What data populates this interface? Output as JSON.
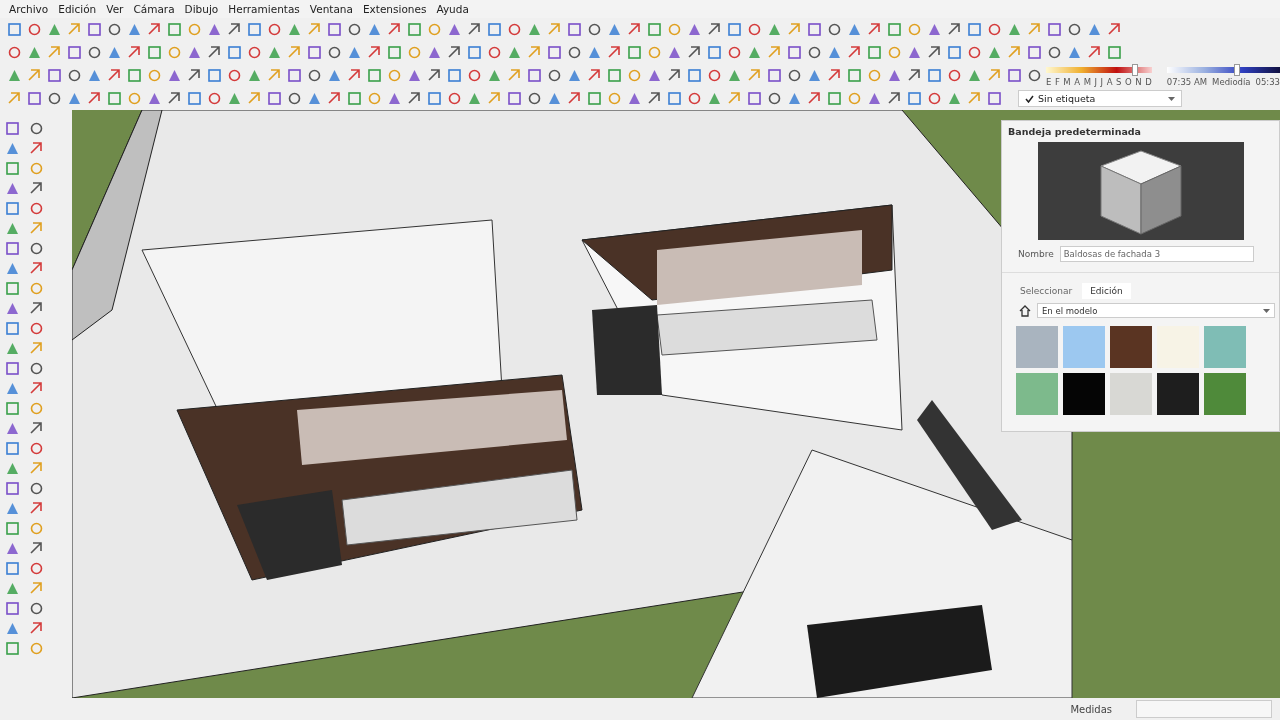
{
  "menu": [
    "Archivo",
    "Edición",
    "Ver",
    "Cámara",
    "Dibujo",
    "Herramientas",
    "Ventana",
    "Extensiones",
    "Ayuda"
  ],
  "shadows": {
    "months": [
      "E",
      "F",
      "M",
      "A",
      "M",
      "J",
      "J",
      "A",
      "S",
      "O",
      "N",
      "D"
    ],
    "month_slider": {
      "level": 0.84
    },
    "time_start": "07:35 AM",
    "time_mid": "Mediodía",
    "time_end": "05:33",
    "time_slider": {
      "level": 0.62
    }
  },
  "tag_dropdown": {
    "value": "Sin etiqueta"
  },
  "tray": {
    "title": "Bandeja predeterminada",
    "name_label": "Nombre",
    "name_value": "Baldosas de fachada 3",
    "tabs": [
      {
        "label": "Seleccionar",
        "selected": false
      },
      {
        "label": "Edición",
        "selected": true
      }
    ],
    "collection": "En el modelo",
    "swatches": [
      {
        "color": "#a9b4bf"
      },
      {
        "color": "#9cc8f0"
      },
      {
        "color": "#5a3422"
      },
      {
        "color": "#f7f3e6"
      },
      {
        "color": "#7fbdb5"
      },
      {
        "color": "#7dba8c"
      },
      {
        "color": "#050505"
      },
      {
        "color": "#d8d8d4"
      },
      {
        "color": "#1e1e1e"
      },
      {
        "color": "#4f8a3a"
      }
    ]
  },
  "status_bar": {
    "measure_label": "Medidas"
  }
}
